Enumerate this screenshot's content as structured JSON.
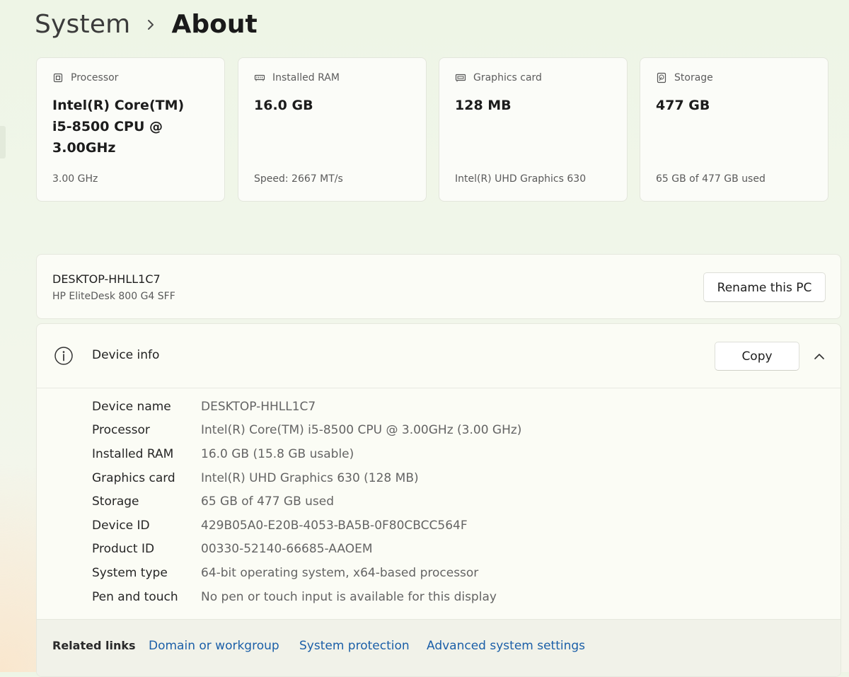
{
  "breadcrumb": {
    "parent": "System",
    "current": "About"
  },
  "cards": [
    {
      "title": "Processor",
      "icon": "processor-icon",
      "value": "Intel(R) Core(TM) i5-8500 CPU @ 3.00GHz",
      "detail": "3.00 GHz"
    },
    {
      "title": "Installed RAM",
      "icon": "ram-icon",
      "value": "16.0 GB",
      "detail": "Speed: 2667 MT/s"
    },
    {
      "title": "Graphics card",
      "icon": "graphics-card-icon",
      "value": "128 MB",
      "detail": "Intel(R) UHD Graphics 630"
    },
    {
      "title": "Storage",
      "icon": "storage-icon",
      "value": "477 GB",
      "detail": "65 GB of 477 GB used"
    }
  ],
  "pc": {
    "name": "DESKTOP-HHLL1C7",
    "model": "HP EliteDesk 800 G4 SFF",
    "rename_label": "Rename this PC"
  },
  "device_info": {
    "title": "Device info",
    "copy_label": "Copy",
    "specs": [
      {
        "label": "Device name",
        "value": "DESKTOP-HHLL1C7"
      },
      {
        "label": "Processor",
        "value": "Intel(R) Core(TM) i5-8500 CPU @ 3.00GHz (3.00 GHz)"
      },
      {
        "label": "Installed RAM",
        "value": "16.0 GB (15.8 GB usable)"
      },
      {
        "label": "Graphics card",
        "value": "Intel(R) UHD Graphics 630 (128 MB)"
      },
      {
        "label": "Storage",
        "value": "65 GB of 477 GB used"
      },
      {
        "label": "Device ID",
        "value": "429B05A0-E20B-4053-BA5B-0F80CBCC564F"
      },
      {
        "label": "Product ID",
        "value": "00330-52140-66685-AAOEM"
      },
      {
        "label": "System type",
        "value": "64-bit operating system, x64-based processor"
      },
      {
        "label": "Pen and touch",
        "value": "No pen or touch input is available for this display"
      }
    ]
  },
  "related_links": {
    "title": "Related links",
    "links": [
      "Domain or workgroup",
      "System protection",
      "Advanced system settings"
    ]
  },
  "colors": {
    "link": "#1b5fa8",
    "card_bg": "#fbfcf8",
    "page_bg": "#eef5e6"
  }
}
